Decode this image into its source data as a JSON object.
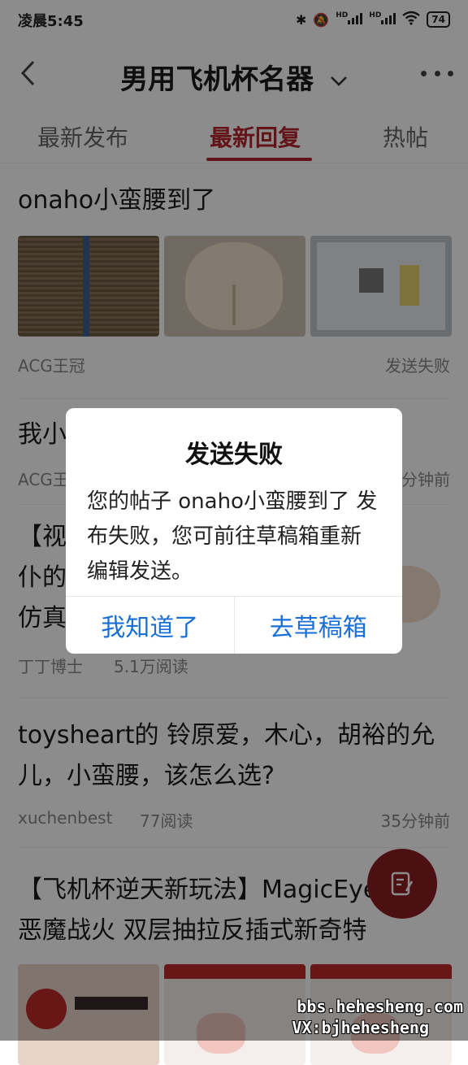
{
  "status": {
    "time": "凌晨5:45",
    "battery": "74",
    "hd1": "HD",
    "hd2": "HD"
  },
  "header": {
    "title": "男用飞机杯名器"
  },
  "tabs": [
    {
      "label": "最新发布"
    },
    {
      "label": "最新回复"
    },
    {
      "label": "热帖"
    }
  ],
  "posts": [
    {
      "title": "onaho小蛮腰到了",
      "author": "ACG王冠",
      "status": "发送失败"
    },
    {
      "title_line1": "我小",
      "author": "ACG王",
      "time": "分钟前"
    },
    {
      "title_line1": "【视",
      "title_line2": "仆的",
      "title_line3": "仿真",
      "author": "丁丁博士",
      "reads": "5.1万阅读"
    },
    {
      "title": "toysheart的 铃原爱，木心，胡裕的允儿，小蛮腰，该怎么选?",
      "author": "xuchenbest",
      "reads": "77阅读",
      "time": "35分钟前"
    },
    {
      "title": "【飞机杯逆天新玩法】MagicEye眼 恶魔战火 双层抽拉反插式新奇特"
    }
  ],
  "dialog": {
    "title": "发送失败",
    "message": "您的帖子 onaho小蛮腰到了 发布失败，您可前往草稿箱重新编辑发送。",
    "cancel_label": "我知道了",
    "confirm_label": "去草稿箱"
  },
  "watermark": {
    "line1": "bbs.hehesheng.com",
    "line2": "VX:bjhehesheng"
  },
  "colors": {
    "accent": "#b6242e",
    "dialog_button": "#1a6fd6",
    "fab": "#8a1e24"
  },
  "icons": {
    "back": "chevron-left-icon",
    "dropdown": "chevron-down-icon",
    "more": "more-dots-icon",
    "compose": "edit-icon"
  }
}
